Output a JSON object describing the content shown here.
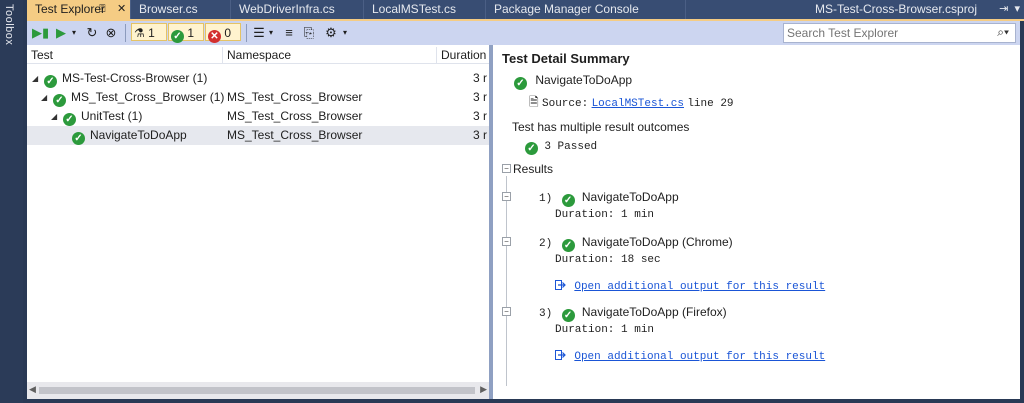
{
  "sidebar": {
    "toolbox_label": "Toolbox"
  },
  "tabs": [
    {
      "label": "Test Explorer",
      "active": true
    },
    {
      "label": "Browser.cs"
    },
    {
      "label": "WebDriverInfra.cs"
    },
    {
      "label": "LocalMSTest.cs"
    },
    {
      "label": "Package Manager Console"
    },
    {
      "label": "MS-Test-Cross-Browser.csproj"
    }
  ],
  "toolbar": {
    "flask_count": "1",
    "passed_count": "1",
    "failed_count": "0",
    "search_placeholder": "Search Test Explorer"
  },
  "tree": {
    "columns": [
      "Test",
      "Namespace",
      "Duration"
    ],
    "rows": [
      {
        "name": "MS-Test-Cross-Browser (1)",
        "namespace": "",
        "duration": "3 r"
      },
      {
        "name": "MS_Test_Cross_Browser (1)",
        "namespace": "MS_Test_Cross_Browser",
        "duration": "3 r"
      },
      {
        "name": "UnitTest (1)",
        "namespace": "MS_Test_Cross_Browser",
        "duration": "3 r"
      },
      {
        "name": "NavigateToDoApp",
        "namespace": "MS_Test_Cross_Browser",
        "duration": "3 r"
      }
    ]
  },
  "detail": {
    "title": "Test Detail Summary",
    "test_name": "NavigateToDoApp",
    "source_label": "Source:",
    "source_file": "LocalMSTest.cs",
    "source_line": "line 29",
    "outcomes_heading": "Test has multiple result outcomes",
    "passed_summary": "3 Passed",
    "results_label": "Results",
    "results": [
      {
        "index": "1)",
        "name": "NavigateToDoApp",
        "duration": "Duration: 1 min",
        "link": ""
      },
      {
        "index": "2)",
        "name": "NavigateToDoApp (Chrome)",
        "duration": "Duration: 18 sec",
        "link": "Open additional output for this result"
      },
      {
        "index": "3)",
        "name": "NavigateToDoApp (Firefox)",
        "duration": "Duration: 1 min",
        "link": "Open additional output for this result"
      }
    ]
  },
  "colors": {
    "accent": "#f5cc84",
    "pass_green": "#2c9a3c",
    "fail_red": "#d32f2f",
    "link_blue": "#1a55d6"
  }
}
